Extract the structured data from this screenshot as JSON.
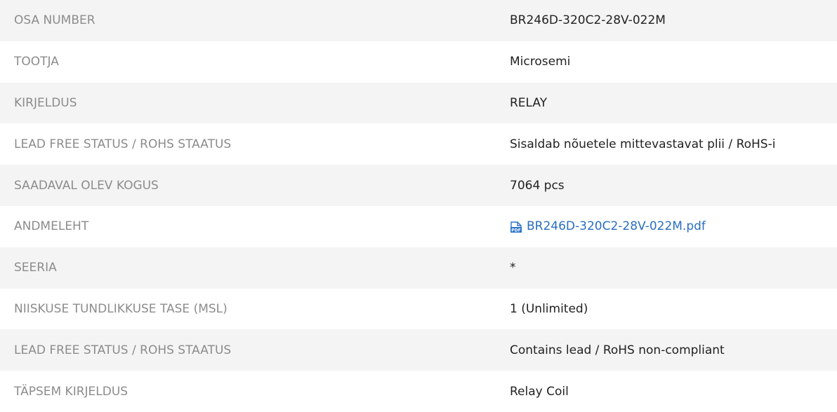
{
  "specs": [
    {
      "label": "OSA NUMBER",
      "value": "BR246D-320C2-28V-022M"
    },
    {
      "label": "TOOTJA",
      "value": "Microsemi"
    },
    {
      "label": "KIRJELDUS",
      "value": "RELAY"
    },
    {
      "label": "LEAD FREE STATUS / ROHS STAATUS",
      "value": "Sisaldab nõuetele mittevastavat plii / RoHS-i"
    },
    {
      "label": "SAADAVAL OLEV KOGUS",
      "value": "7064 pcs"
    },
    {
      "label": "ANDMELEHT",
      "value": "BR246D-320C2-28V-022M.pdf",
      "icon": "pdf-icon"
    },
    {
      "label": "SEERIA",
      "value": "*"
    },
    {
      "label": "NIISKUSE TUNDLIKKUSE TASE (MSL)",
      "value": "1 (Unlimited)"
    },
    {
      "label": "LEAD FREE STATUS / ROHS STAATUS",
      "value": "Contains lead / RoHS non-compliant"
    },
    {
      "label": "TÄPSEM KIRJELDUS",
      "value": "Relay Coil"
    }
  ],
  "colors": {
    "row_shaded": "#f4f4f4",
    "label_text": "#8c8c8c",
    "value_text": "#222222",
    "link": "#2a6ebf",
    "pdf_icon": "#2b73c8"
  }
}
